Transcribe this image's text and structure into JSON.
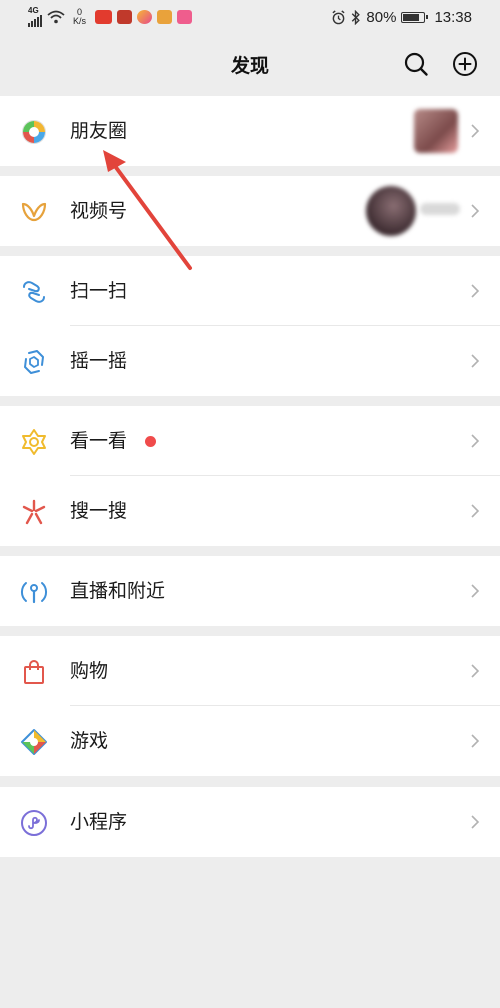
{
  "status_bar": {
    "network": "4G",
    "speed_value": "0",
    "speed_unit": "K/s",
    "battery": "80%",
    "battery_level": 0.8,
    "time": "13:38",
    "apps": [
      "red-news-app-icon",
      "game-app-icon",
      "video-app-icon",
      "food-app-icon",
      "pink-app-icon"
    ]
  },
  "header": {
    "title": "发现"
  },
  "menu": {
    "moments": "朋友圈",
    "channels": "视频号",
    "scan": "扫一扫",
    "shake": "摇一摇",
    "top_stories": "看一看",
    "search": "搜一搜",
    "live_nearby": "直播和附近",
    "shopping": "购物",
    "games": "游戏",
    "mini_programs": "小程序"
  },
  "colors": {
    "background": "#ededed",
    "notification_dot": "#f04b4b",
    "annotation_arrow": "#e2443b",
    "chevron": "#b2b2b2"
  }
}
